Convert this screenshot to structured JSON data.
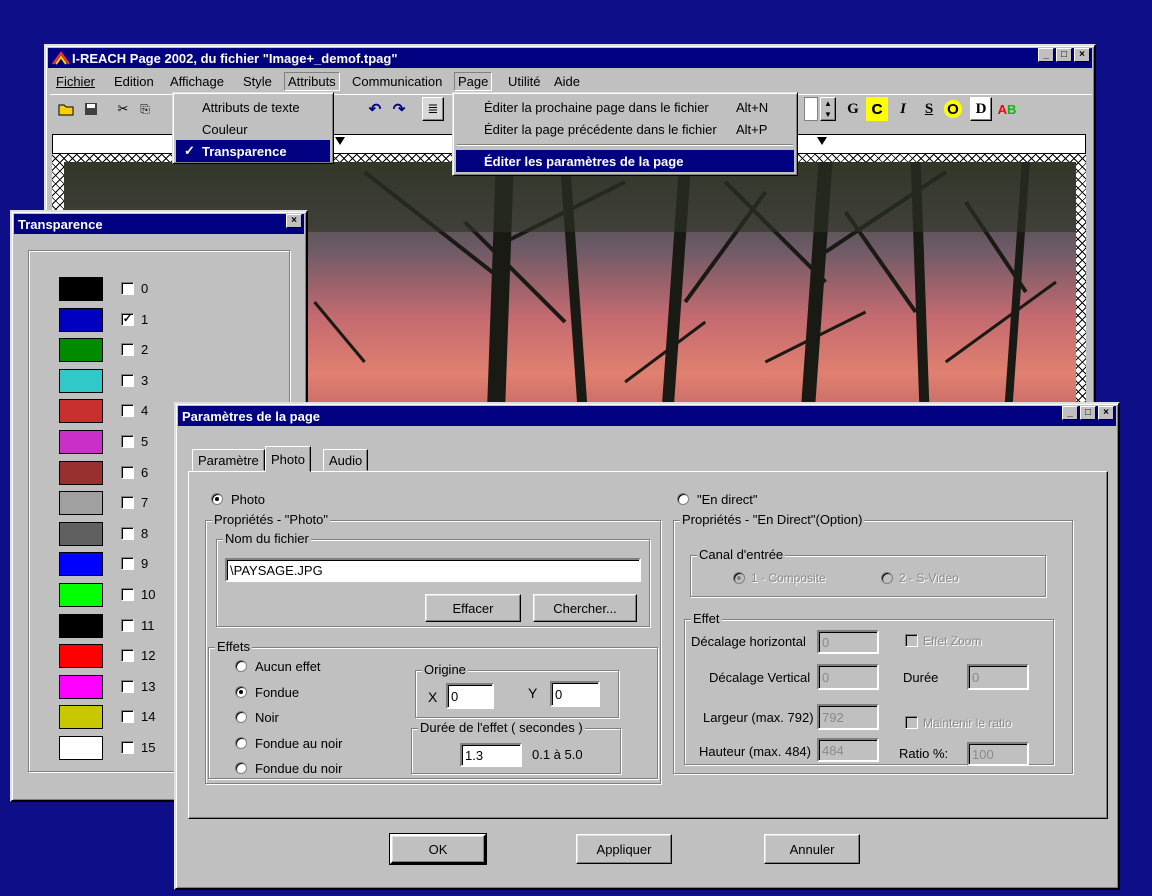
{
  "main_window": {
    "title": "I-REACH  Page 2002,  du fichier \"Image+_demof.tpag\"",
    "menubar": [
      "Fichier",
      "Edition",
      "Affichage",
      "Style",
      "Attributs",
      "Communication",
      "Page",
      "Utilité",
      "Aide"
    ],
    "toolbar": {
      "bold": "G",
      "c": "C",
      "italic": "I",
      "underline": "S",
      "o": "O",
      "d": "D",
      "ab_a": "A",
      "ab_b": "B"
    }
  },
  "attributs_menu": {
    "items": [
      "Attributs de texte",
      "Couleur",
      "Transparence"
    ],
    "check": "✓"
  },
  "page_menu": {
    "items": [
      {
        "label": "Éditer la prochaine page dans le fichier",
        "shortcut": "Alt+N"
      },
      {
        "label": "Éditer la page précédente dans le fichier",
        "shortcut": "Alt+P"
      },
      {
        "label": "Éditer les paramètres de la page",
        "shortcut": ""
      }
    ]
  },
  "transparence": {
    "title": "Transparence",
    "entries": [
      {
        "n": "0",
        "color": "#000000",
        "checked": false
      },
      {
        "n": "1",
        "color": "#0000c0",
        "checked": true
      },
      {
        "n": "2",
        "color": "#008a00",
        "checked": false
      },
      {
        "n": "3",
        "color": "#30c8c8",
        "checked": false
      },
      {
        "n": "4",
        "color": "#c83030",
        "checked": false
      },
      {
        "n": "5",
        "color": "#c830c8",
        "checked": false
      },
      {
        "n": "6",
        "color": "#983030",
        "checked": false
      },
      {
        "n": "7",
        "color": "#a0a0a0",
        "checked": false
      },
      {
        "n": "8",
        "color": "#606060",
        "checked": false
      },
      {
        "n": "9",
        "color": "#0000ff",
        "checked": false
      },
      {
        "n": "10",
        "color": "#00ff00",
        "checked": false
      },
      {
        "n": "11",
        "color": "#000000",
        "checked": false
      },
      {
        "n": "12",
        "color": "#ff0000",
        "checked": false
      },
      {
        "n": "13",
        "color": "#ff00ff",
        "checked": false
      },
      {
        "n": "14",
        "color": "#c8c800",
        "checked": false
      },
      {
        "n": "15",
        "color": "#ffffff",
        "checked": false
      }
    ]
  },
  "params": {
    "title": "Paramètres de la page",
    "tabs": [
      "Paramètre",
      "Photo",
      "Audio"
    ],
    "photo_radio": "Photo",
    "direct_radio": "\"En direct\"",
    "photo_props": "Propriétés - \"Photo\"",
    "filename_group": "Nom du fichier",
    "filename": "\\PAYSAGE.JPG",
    "effacer": "Effacer",
    "chercher": "Chercher...",
    "effets_group": "Effets",
    "effets": [
      "Aucun effet",
      "Fondue",
      "Noir",
      "Fondue au noir",
      "Fondue du noir"
    ],
    "effet_selected": 1,
    "origine_group": "Origine",
    "x_label": "X",
    "x_value": "0",
    "y_label": "Y",
    "y_value": "0",
    "duree_group": "Durée de l'effet  ( secondes )",
    "duree_value": "1.3",
    "duree_range": "0.1 à 5.0",
    "direct_props": "Propriétés - \"En Direct\"(Option)",
    "canal_group": "Canal d'entrée",
    "canal1": "1 - Composite",
    "canal2": "2 - S-Video",
    "effet_group": "Effet",
    "dec_h": "Décalage horizontal",
    "dec_h_v": "0",
    "dec_v": "Décalage Vertical",
    "dec_v_v": "0",
    "zoom": "Effet Zoom",
    "duree2": "Durée",
    "duree2_v": "0",
    "largeur": "Largeur (max. 792)",
    "largeur_v": "792",
    "hauteur": "Hauteur (max. 484)",
    "hauteur_v": "484",
    "ratio_chk": "Maintenir le ratio",
    "ratio": "Ratio %:",
    "ratio_v": "100",
    "ok": "OK",
    "appliquer": "Appliquer",
    "annuler": "Annuler"
  },
  "colors": {
    "titlebar": "#000080",
    "desktop": "#0e0e88",
    "face": "#c0c0c0"
  }
}
